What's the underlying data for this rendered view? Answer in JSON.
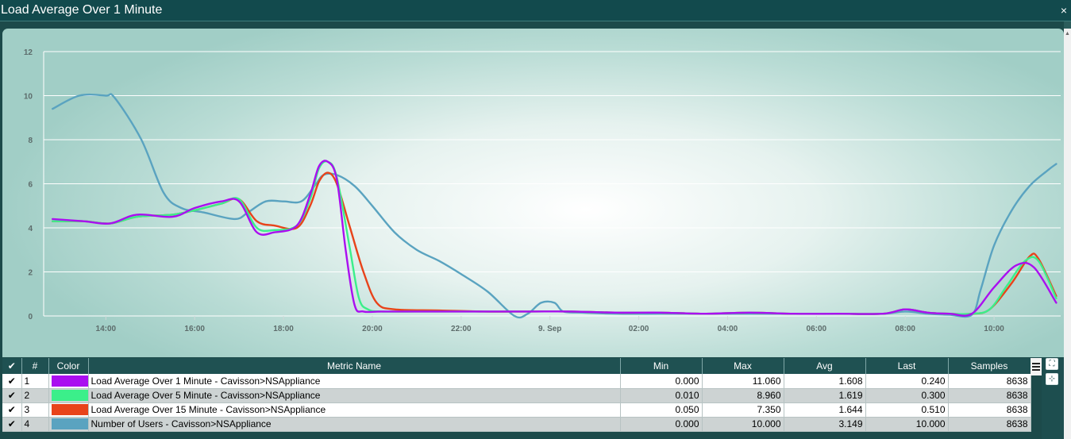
{
  "window": {
    "title": "Load Average Over 1 Minute",
    "close_label": "×"
  },
  "chart_data": {
    "type": "line",
    "title": "",
    "xlabel": "",
    "ylabel": "",
    "ylim": [
      0,
      12
    ],
    "y_ticks": [
      0,
      2,
      4,
      6,
      8,
      10,
      12
    ],
    "x_hour_range": [
      12.6,
      35.5
    ],
    "x_ticks": [
      {
        "h": 14,
        "label": "14:00"
      },
      {
        "h": 16,
        "label": "16:00"
      },
      {
        "h": 18,
        "label": "18:00"
      },
      {
        "h": 20,
        "label": "20:00"
      },
      {
        "h": 22,
        "label": "22:00"
      },
      {
        "h": 24,
        "label": "9. Sep"
      },
      {
        "h": 26,
        "label": "02:00"
      },
      {
        "h": 28,
        "label": "04:00"
      },
      {
        "h": 30,
        "label": "06:00"
      },
      {
        "h": 32,
        "label": "08:00"
      },
      {
        "h": 34,
        "label": "10:00"
      }
    ],
    "grid": true,
    "series": [
      {
        "name": "Number of Users - Cavisson>NSAppliance",
        "color": "#5aa3c0",
        "x": [
          12.8,
          13.4,
          14.0,
          14.2,
          14.8,
          15.3,
          15.7,
          16.2,
          16.9,
          17.2,
          17.6,
          18.0,
          18.4,
          18.7,
          18.9,
          19.2,
          19.6,
          20.0,
          20.5,
          21.0,
          21.5,
          22.0,
          22.6,
          23.2,
          23.5,
          23.8,
          24.1,
          24.3,
          24.7,
          25.5,
          26.5,
          27.5,
          28.5,
          29.5,
          30.5,
          31.5,
          32.0,
          32.5,
          33.0,
          33.5,
          33.7,
          34.0,
          34.4,
          34.8,
          35.2,
          35.4
        ],
        "values": [
          9.4,
          10.0,
          10.0,
          9.9,
          8.0,
          5.6,
          4.9,
          4.7,
          4.4,
          4.7,
          5.2,
          5.2,
          5.2,
          5.9,
          6.4,
          6.4,
          5.9,
          5.0,
          3.8,
          3.0,
          2.5,
          1.9,
          1.1,
          0.0,
          0.1,
          0.6,
          0.6,
          0.2,
          0.15,
          0.1,
          0.1,
          0.1,
          0.1,
          0.1,
          0.1,
          0.1,
          0.2,
          0.1,
          0.05,
          0.05,
          1.2,
          3.2,
          4.8,
          5.9,
          6.6,
          6.9
        ]
      },
      {
        "name": "Load Average Over 15 Minute - Cavisson>NSAppliance",
        "color": "#e8431a",
        "x": [
          12.8,
          13.5,
          14.1,
          14.7,
          15.5,
          16.0,
          16.6,
          17.0,
          17.4,
          17.8,
          18.3,
          18.6,
          18.8,
          19.0,
          19.2,
          19.5,
          19.8,
          20.1,
          20.5,
          21.5,
          22.5,
          23.5,
          24.5,
          25.5,
          26.5,
          27.5,
          28.5,
          29.5,
          30.5,
          31.5,
          32.0,
          32.5,
          33.0,
          33.5,
          33.9,
          34.4,
          34.8,
          35.0,
          35.4
        ],
        "values": [
          4.3,
          4.3,
          4.2,
          4.5,
          4.6,
          4.8,
          5.1,
          5.3,
          4.3,
          4.1,
          4.0,
          5.0,
          6.1,
          6.5,
          6.0,
          4.0,
          2.0,
          0.6,
          0.3,
          0.25,
          0.2,
          0.2,
          0.2,
          0.15,
          0.15,
          0.1,
          0.15,
          0.1,
          0.1,
          0.1,
          0.3,
          0.15,
          0.1,
          0.1,
          0.3,
          1.5,
          2.7,
          2.6,
          0.9
        ]
      },
      {
        "name": "Load Average Over 5 Minute - Cavisson>NSAppliance",
        "color": "#3bef8a",
        "x": [
          12.8,
          13.5,
          14.1,
          14.7,
          15.5,
          16.0,
          16.6,
          17.0,
          17.4,
          17.8,
          18.3,
          18.6,
          18.8,
          19.0,
          19.2,
          19.5,
          19.7,
          19.9,
          20.2,
          21.0,
          22.0,
          23.5,
          24.5,
          25.5,
          26.5,
          27.5,
          28.5,
          29.5,
          30.5,
          31.5,
          32.0,
          32.5,
          33.0,
          33.5,
          33.9,
          34.3,
          34.7,
          35.0,
          35.4
        ],
        "values": [
          4.3,
          4.3,
          4.2,
          4.5,
          4.6,
          4.8,
          5.1,
          5.3,
          4.0,
          3.9,
          4.1,
          5.3,
          6.7,
          7.0,
          6.3,
          3.0,
          0.8,
          0.3,
          0.2,
          0.2,
          0.2,
          0.2,
          0.2,
          0.15,
          0.15,
          0.1,
          0.15,
          0.1,
          0.1,
          0.1,
          0.3,
          0.15,
          0.1,
          0.1,
          0.3,
          1.4,
          2.5,
          2.5,
          0.8
        ]
      },
      {
        "name": "Load Average Over 1 Minute - Cavisson>NSAppliance",
        "color": "#aa0ff0",
        "x": [
          12.8,
          13.5,
          14.1,
          14.7,
          15.5,
          16.0,
          16.6,
          17.0,
          17.4,
          17.8,
          18.3,
          18.6,
          18.8,
          19.0,
          19.2,
          19.4,
          19.6,
          19.8,
          20.2,
          21.0,
          22.0,
          23.5,
          24.5,
          25.5,
          26.5,
          27.5,
          28.5,
          29.5,
          30.5,
          31.5,
          32.0,
          32.5,
          33.0,
          33.5,
          34.0,
          34.5,
          34.9,
          35.4
        ],
        "values": [
          4.4,
          4.3,
          4.2,
          4.6,
          4.5,
          4.9,
          5.2,
          5.2,
          3.8,
          3.8,
          4.1,
          5.5,
          6.8,
          7.0,
          6.2,
          3.0,
          0.5,
          0.2,
          0.2,
          0.2,
          0.2,
          0.2,
          0.2,
          0.15,
          0.15,
          0.1,
          0.15,
          0.1,
          0.1,
          0.1,
          0.3,
          0.15,
          0.1,
          0.1,
          1.3,
          2.3,
          2.2,
          0.6
        ]
      }
    ]
  },
  "table": {
    "headers": {
      "check": "✔",
      "index": "#",
      "color": "Color",
      "name": "Metric Name",
      "min": "Min",
      "max": "Max",
      "avg": "Avg",
      "last": "Last",
      "samples": "Samples"
    },
    "rows": [
      {
        "check": "✔",
        "index": "1",
        "color": "#aa0ff0",
        "name": "Load Average Over 1 Minute - Cavisson>NSAppliance",
        "min": "0.000",
        "max": "11.060",
        "avg": "1.608",
        "last": "0.240",
        "samples": "8638"
      },
      {
        "check": "✔",
        "index": "2",
        "color": "#3bef8a",
        "name": "Load Average Over 5 Minute - Cavisson>NSAppliance",
        "min": "0.010",
        "max": "8.960",
        "avg": "1.619",
        "last": "0.300",
        "samples": "8638"
      },
      {
        "check": "✔",
        "index": "3",
        "color": "#e8431a",
        "name": "Load Average Over 15 Minute - Cavisson>NSAppliance",
        "min": "0.050",
        "max": "7.350",
        "avg": "1.644",
        "last": "0.510",
        "samples": "8638"
      },
      {
        "check": "✔",
        "index": "4",
        "color": "#5aa3c0",
        "name": "Number of Users - Cavisson>NSAppliance",
        "min": "0.000",
        "max": "10.000",
        "avg": "3.149",
        "last": "10.000",
        "samples": "8638"
      }
    ]
  },
  "tools": {
    "expand_icon": "⛶",
    "collapse_icon": "⊹"
  }
}
